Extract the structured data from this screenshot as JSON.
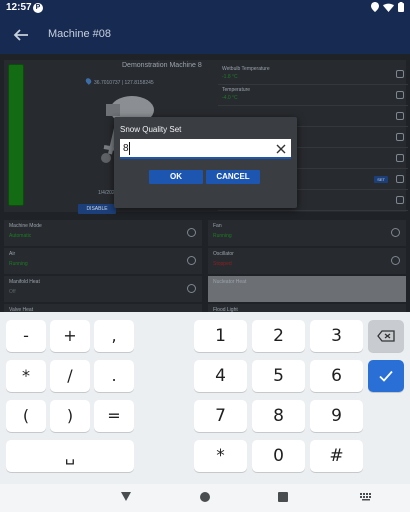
{
  "status_bar": {
    "time": "12:57",
    "app_icon_letter": "P"
  },
  "app_bar": {
    "title": "Machine #08"
  },
  "machine": {
    "name": "Demonstration Machine 8",
    "location": "36.7010737 | 127.8158245",
    "date": "1/4/2023",
    "disable_label": "DISABLE",
    "level_color": "#136b13"
  },
  "readings": [
    {
      "label": "Wetbulb Temperature",
      "value": "-1.8 °C",
      "icon": "wetbulb-icon"
    },
    {
      "label": "Temperature",
      "value": "-4.0 °C",
      "icon": "thermometer-icon"
    },
    {
      "label": "",
      "value": "",
      "icon": "humidity-icon"
    },
    {
      "label": "",
      "value": "",
      "icon": "wind-icon"
    },
    {
      "label": "",
      "value": "",
      "icon": "gauge-icon"
    },
    {
      "label": "",
      "value": "",
      "icon": "bars-icon",
      "badge": "SET"
    },
    {
      "label": "",
      "value": "",
      "icon": "power-icon"
    }
  ],
  "grid": [
    {
      "label": "Machine Mode",
      "value": "Automatic",
      "tone": "green",
      "icon": "mode-icon"
    },
    {
      "label": "Fan",
      "value": "Running",
      "tone": "green",
      "icon": "fan-icon"
    },
    {
      "label": "Air",
      "value": "Running",
      "tone": "green",
      "icon": "air-icon"
    },
    {
      "label": "Oscillator",
      "value": "Stopped",
      "tone": "red",
      "icon": "oscillator-icon"
    },
    {
      "label": "Manifold Heat",
      "value": "Off",
      "tone": "dim",
      "icon": "heat-icon"
    },
    {
      "label": "Nucleator Heat",
      "value": "",
      "tone": "dim",
      "icon": ""
    },
    {
      "label": "Valve Heat",
      "value": "",
      "tone": "dim",
      "icon": ""
    },
    {
      "label": "Flood Light",
      "value": "",
      "tone": "dim",
      "icon": ""
    }
  ],
  "dialog": {
    "title": "Snow Quality Set",
    "input_value": "8",
    "ok_label": "OK",
    "cancel_label": "CANCEL"
  },
  "keyboard": {
    "left_keys": [
      "-",
      "+",
      ",",
      "*",
      "/",
      ".",
      "(",
      ")",
      "="
    ],
    "digits": [
      "1",
      "2",
      "3",
      "4",
      "5",
      "6",
      "7",
      "8",
      "9"
    ],
    "bottom_keys": [
      "*",
      "0",
      "#"
    ],
    "space_glyph": "␣",
    "accent": "#2a6fd6"
  }
}
